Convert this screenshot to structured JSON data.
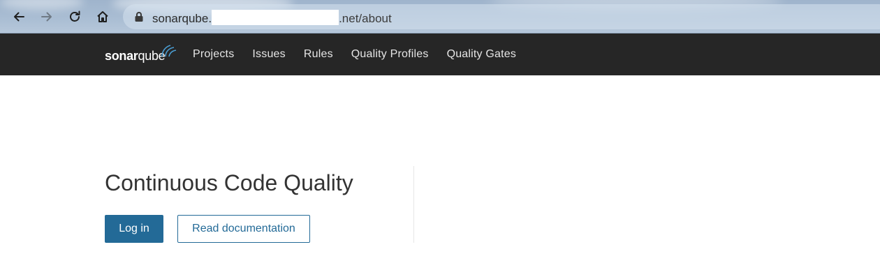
{
  "browser": {
    "url_prefix": "sonarqube.",
    "url_suffix": ".net/about",
    "icons": {
      "back": "arrow-left-icon",
      "forward": "arrow-right-icon",
      "reload": "reload-icon",
      "home": "home-icon",
      "lock": "lock-icon"
    }
  },
  "app": {
    "logo": {
      "part1": "sonar",
      "part2": "qube"
    },
    "nav": [
      {
        "label": "Projects"
      },
      {
        "label": "Issues"
      },
      {
        "label": "Rules"
      },
      {
        "label": "Quality Profiles"
      },
      {
        "label": "Quality Gates"
      }
    ]
  },
  "main": {
    "headline": "Continuous Code Quality",
    "login_label": "Log in",
    "docs_label": "Read documentation"
  },
  "colors": {
    "topnav_bg": "#262626",
    "primary": "#236a97",
    "headline_text": "#333333"
  }
}
